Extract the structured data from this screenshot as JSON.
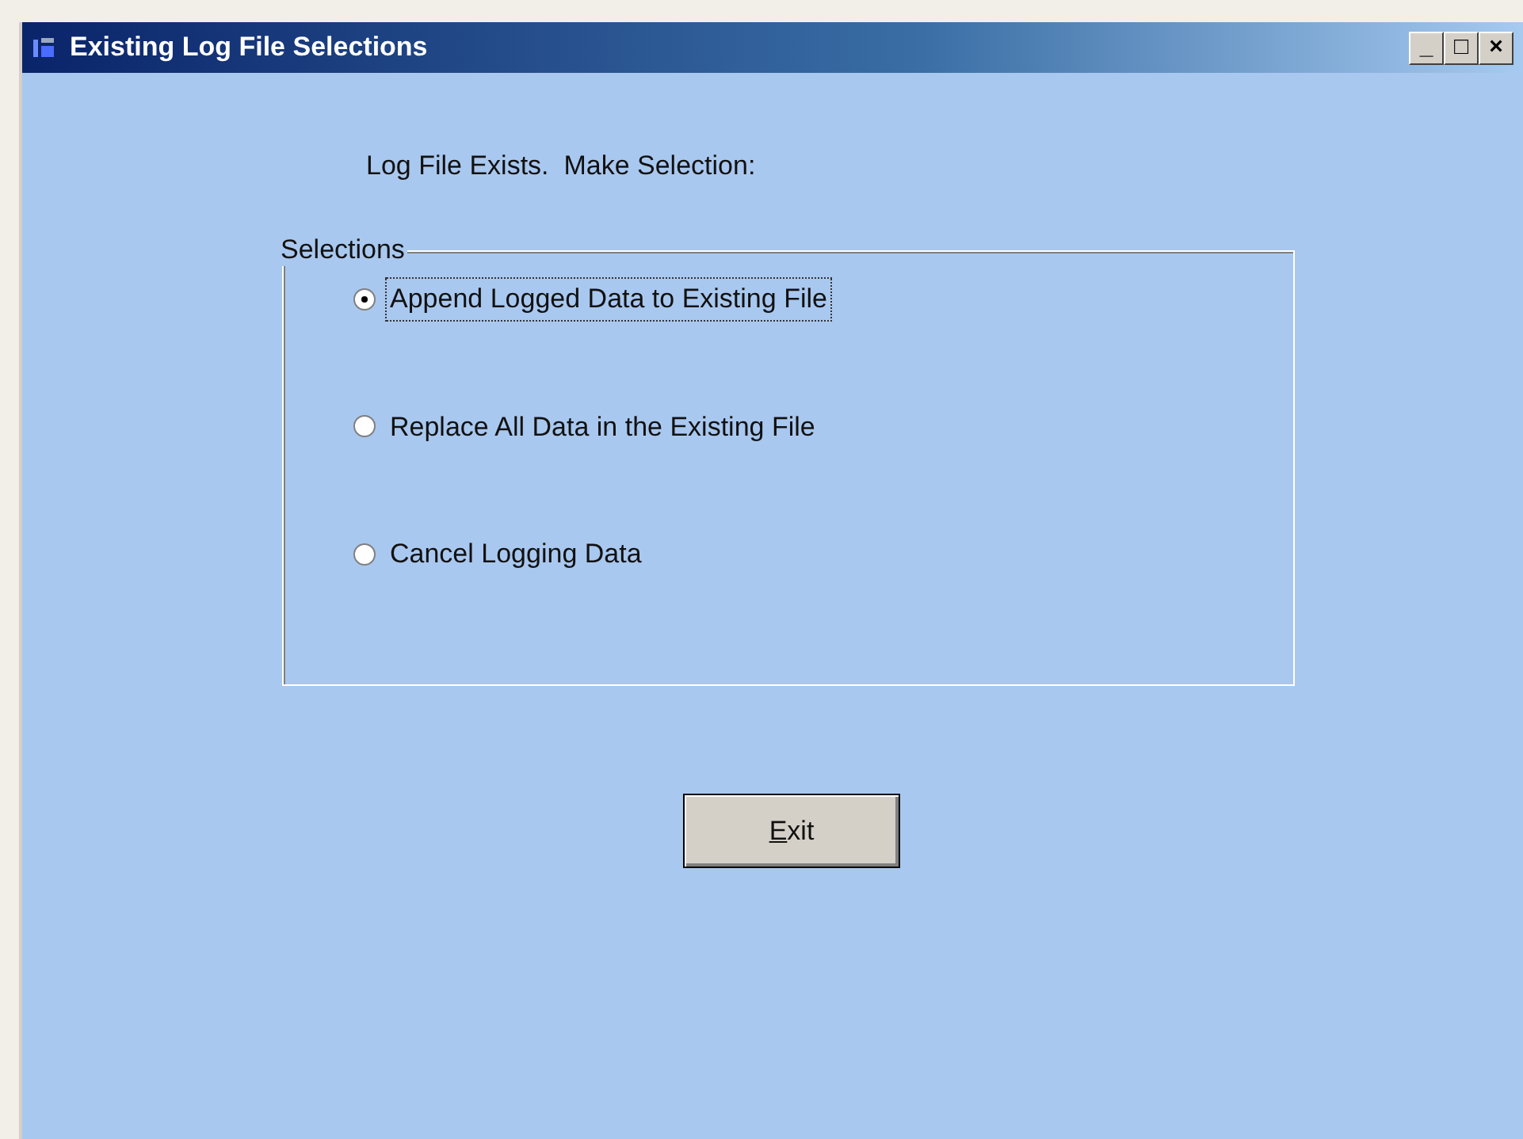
{
  "window": {
    "title": "Existing Log File Selections",
    "controls": [
      "_",
      "□",
      "×"
    ]
  },
  "prompt": "Log File Exists.  Make Selection:",
  "group": {
    "legend": "Selections",
    "options": [
      {
        "label": "Append Logged Data to Existing File",
        "selected": true
      },
      {
        "label": "Replace All Data in the Existing File",
        "selected": false
      },
      {
        "label": "Cancel Logging Data",
        "selected": false
      }
    ]
  },
  "exit_button": {
    "label": "Exit",
    "mnemonic_underlined": true
  }
}
